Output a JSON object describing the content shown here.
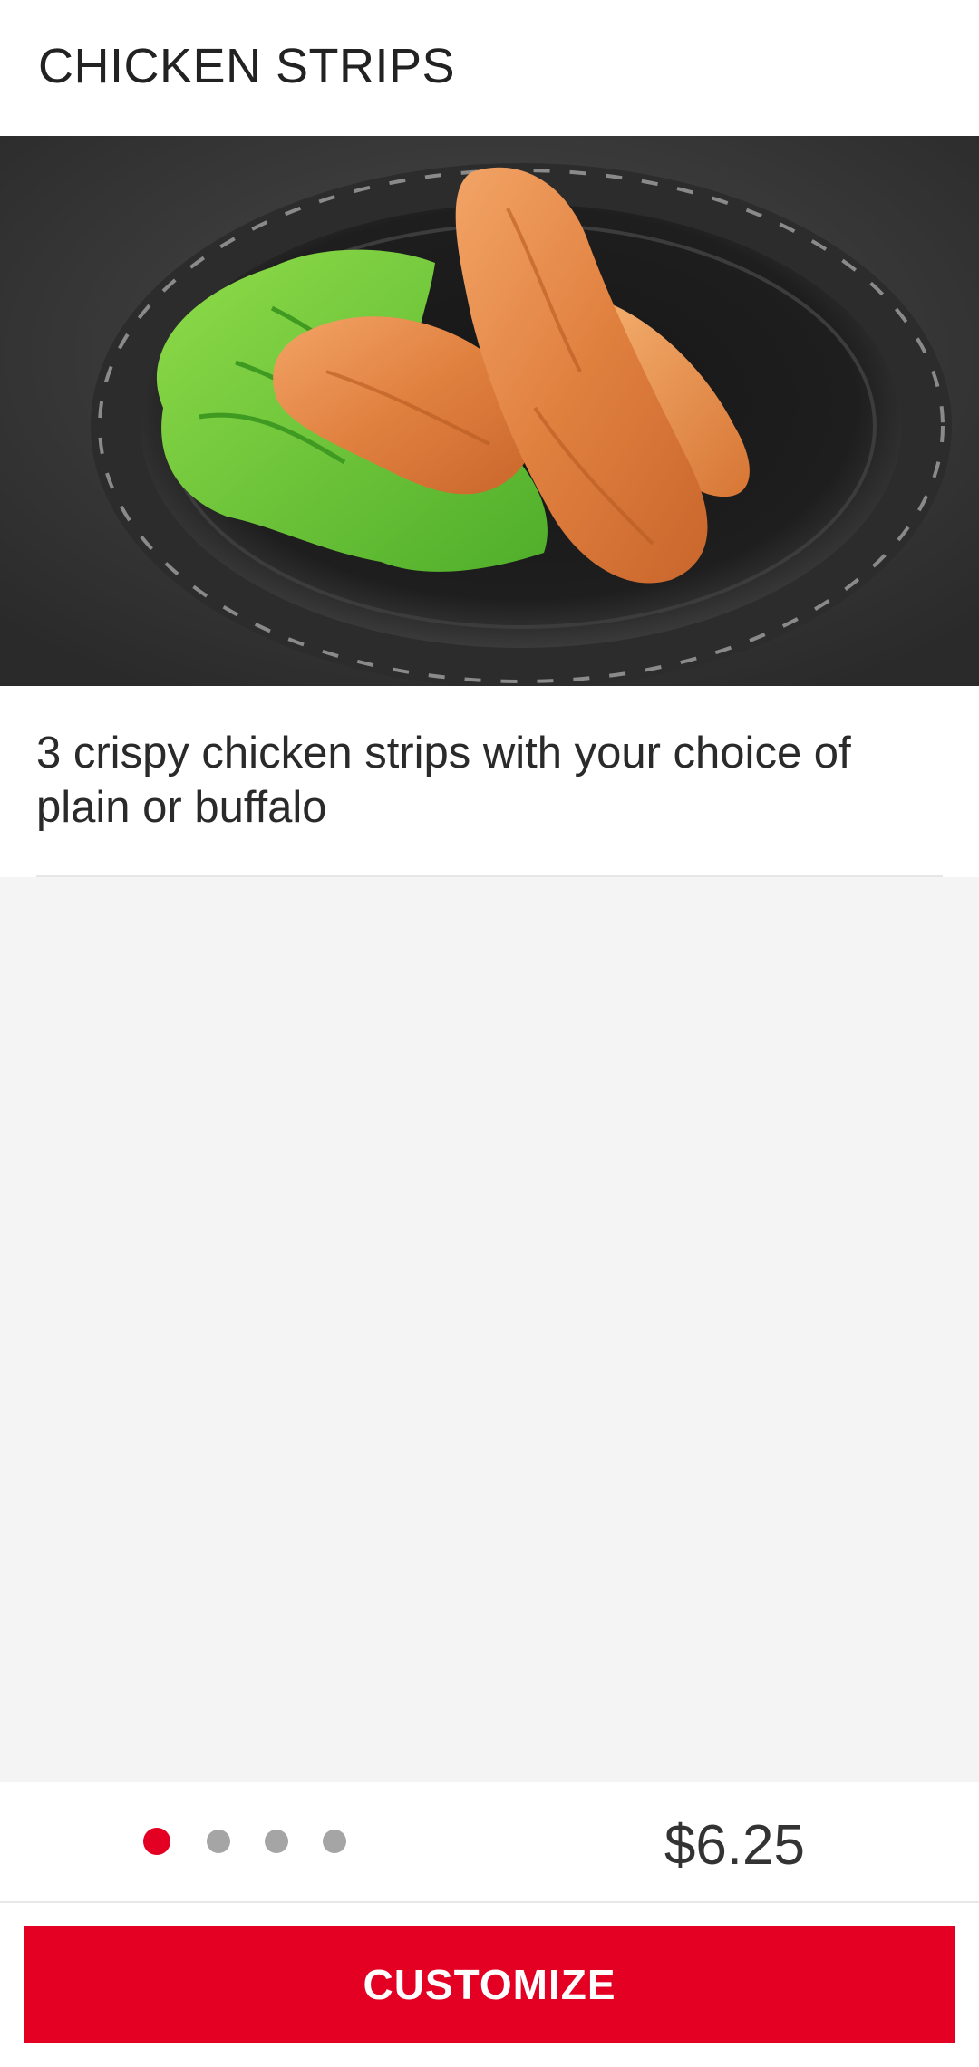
{
  "header": {
    "title": "CHICKEN STRIPS"
  },
  "hero": {
    "image": "chicken-strips-photo"
  },
  "item": {
    "description": "3 crispy chicken strips with your choice of plain or buffalo",
    "price": "$6.25"
  },
  "pager": {
    "count": 4,
    "active_index": 0
  },
  "actions": {
    "customize_label": "CUSTOMIZE"
  },
  "colors": {
    "accent": "#e30022",
    "dot_inactive": "#a5a5a5",
    "panel_bg": "#f4f4f4"
  }
}
